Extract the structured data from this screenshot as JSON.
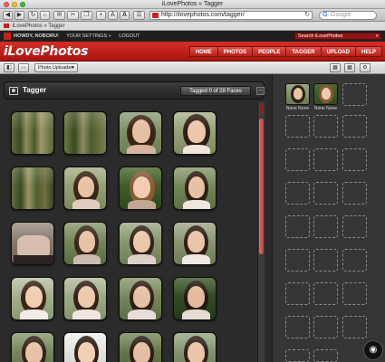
{
  "window": {
    "title": "iLovePhotos » Tagger",
    "traffic_lights": [
      "#ff5f57",
      "#febc2e",
      "#28c840"
    ]
  },
  "toolbar": {
    "back": "◀",
    "forward": "▶",
    "reload": "↻",
    "home": "⌂",
    "buttons": [
      "✉",
      "✂",
      "❐",
      "+",
      "A",
      "A",
      "☰"
    ],
    "url": "http://ilovephotos.com/tagger/",
    "search_placeholder": "Google"
  },
  "bookmarks": {
    "label": "iLovePhotos » Tagger"
  },
  "site": {
    "greeting": "HOWDY, NOBORU!",
    "settings_link": "YOUR SETTINGS »",
    "logout_link": "LOGOUT",
    "search_placeholder": "Search iLovePhotos",
    "logo": "iLovePhotos",
    "nav": [
      "HOME",
      "PHOTOS",
      "PEOPLE",
      "TAGGER",
      "UPLOAD",
      "HELP"
    ],
    "brand_color": "#c9211e"
  },
  "subbar": {
    "uploader_label": "Photo Uploader"
  },
  "tagger": {
    "title": "Tagger",
    "tagged_count_text": "Tagged 0 of 28 Faces",
    "collapse_symbol": "–"
  },
  "people": [
    {
      "name": "None None"
    },
    {
      "name": "None None"
    }
  ],
  "badge": {
    "icon": "apple-icon"
  }
}
